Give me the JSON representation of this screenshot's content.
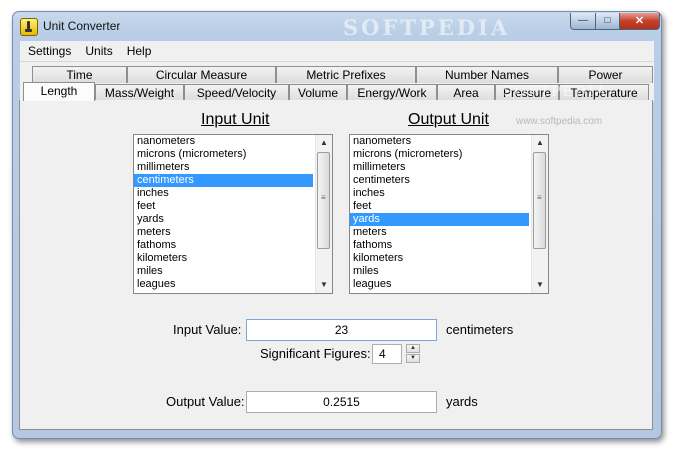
{
  "window": {
    "title": "Unit Converter",
    "watermark": "SOFTPEDIA",
    "controls": {
      "minimize": "—",
      "maximize": "□",
      "close": "✕"
    }
  },
  "menu": [
    "Settings",
    "Units",
    "Help"
  ],
  "tabs_back": [
    "Time",
    "Circular Measure",
    "Metric Prefixes",
    "Number Names",
    "Power"
  ],
  "tabs_front": [
    "Length",
    "Mass/Weight",
    "Speed/Velocity",
    "Volume",
    "Energy/Work",
    "Area",
    "Pressure",
    "Temperature"
  ],
  "active_tab": "Length",
  "watermark_small": "www.softpedia.com",
  "watermark_tab": "SOFTPEDIA",
  "input_unit": {
    "title": "Input Unit",
    "items": [
      "nanometers",
      "microns (micrometers)",
      "millimeters",
      "centimeters",
      "inches",
      "feet",
      "yards",
      "meters",
      "fathoms",
      "kilometers",
      "miles",
      "leagues"
    ],
    "selected": "centimeters"
  },
  "output_unit": {
    "title": "Output Unit",
    "items": [
      "nanometers",
      "microns (micrometers)",
      "millimeters",
      "centimeters",
      "inches",
      "feet",
      "yards",
      "meters",
      "fathoms",
      "kilometers",
      "miles",
      "leagues"
    ],
    "selected": "yards"
  },
  "input_value": {
    "label": "Input Value:",
    "value": "23",
    "unit": "centimeters"
  },
  "significant_figures": {
    "label": "Significant Figures:",
    "value": "4"
  },
  "output_value": {
    "label": "Output Value:",
    "value": "0.2515",
    "unit": "yards"
  },
  "icons": {
    "scroll_up": "▲",
    "scroll_down": "▼",
    "spin_up": "▲",
    "spin_down": "▼",
    "grip": "≡"
  }
}
